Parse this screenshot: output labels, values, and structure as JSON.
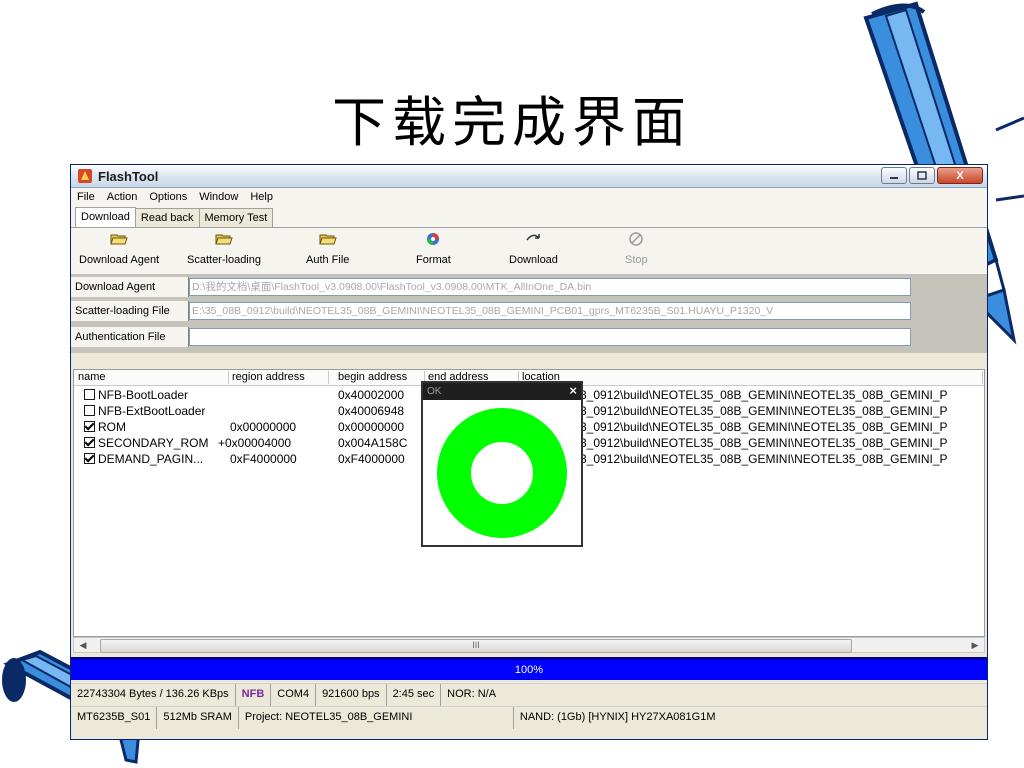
{
  "slide": {
    "title": "下载完成界面"
  },
  "window": {
    "title": "FlashTool",
    "close_glyph": "X",
    "menu": [
      "File",
      "Action",
      "Options",
      "Window",
      "Help"
    ],
    "tabs": [
      "Download",
      "Read back",
      "Memory Test"
    ],
    "toolbar": [
      "Download Agent",
      "Scatter-loading",
      "Auth File",
      "Format",
      "Download",
      "Stop"
    ],
    "paths": [
      {
        "label": "Download Agent",
        "value": "D:\\我的文档\\桌面\\FlashTool_v3.0908.00\\FlashTool_v3.0908.00\\MTK_AllInOne_DA.bin"
      },
      {
        "label": "Scatter-loading File",
        "value": "E:\\35_08B_0912\\build\\NEOTEL35_08B_GEMINI\\NEOTEL35_08B_GEMINI_PCB01_gprs_MT6235B_S01.HUAYU_P1320_V"
      },
      {
        "label": "Authentication File",
        "value": ""
      }
    ],
    "list": {
      "headers": [
        "name",
        "region address",
        "begin address",
        "end address",
        "location"
      ],
      "rows": [
        {
          "checked": false,
          "name": "NFB-BootLoader",
          "region": "",
          "begin": "0x40002000",
          "location": "3_0912\\build\\NEOTEL35_08B_GEMINI\\NEOTEL35_08B_GEMINI_P"
        },
        {
          "checked": false,
          "name": "NFB-ExtBootLoader",
          "region": "",
          "begin": "0x40006948",
          "location": "3_0912\\build\\NEOTEL35_08B_GEMINI\\NEOTEL35_08B_GEMINI_P"
        },
        {
          "checked": true,
          "name": "ROM",
          "region": "0x00000000",
          "begin": "0x00000000",
          "location": "3_0912\\build\\NEOTEL35_08B_GEMINI\\NEOTEL35_08B_GEMINI_P"
        },
        {
          "checked": true,
          "name": "SECONDARY_ROM",
          "region": "+0x00004000",
          "begin": "0x004A158C",
          "location": "3_0912\\build\\NEOTEL35_08B_GEMINI\\NEOTEL35_08B_GEMINI_P"
        },
        {
          "checked": true,
          "name": "DEMAND_PAGIN...",
          "region": "0xF4000000",
          "begin": "0xF4000000",
          "location": "3_0912\\build\\NEOTEL35_08B_GEMINI\\NEOTEL35_08B_GEMINI_P"
        }
      ]
    },
    "scroll_thumb": "III",
    "progress": {
      "text": "100%",
      "fraction": 1.0
    },
    "status1": [
      "22743304 Bytes / 136.26 KBps",
      "NFB",
      "COM4",
      "921600 bps",
      "2:45 sec",
      "NOR: N/A"
    ],
    "status2": [
      "MT6235B_S01",
      "512Mb SRAM",
      "Project: NEOTEL35_08B_GEMINI",
      "NAND: (1Gb) [HYNIX] HY27XA081G1M"
    ],
    "popup": {
      "title": "OK",
      "close": "×",
      "ring_color": "#00ff00"
    }
  }
}
